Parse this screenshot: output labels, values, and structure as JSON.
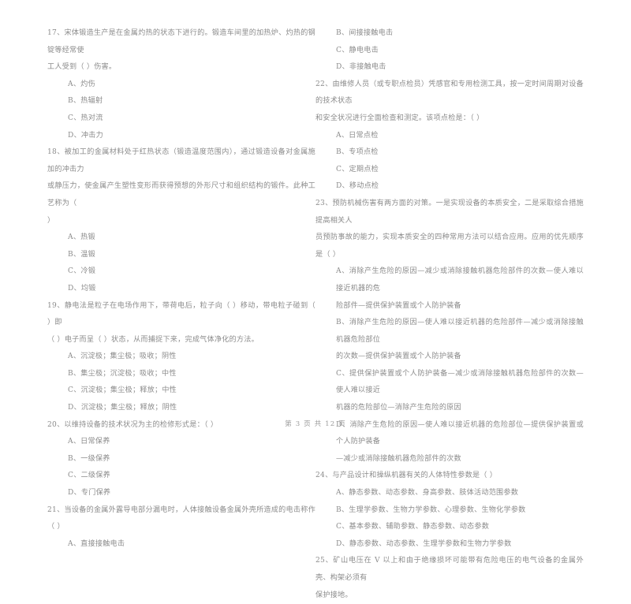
{
  "document": {
    "type": "exam-paper",
    "language": "zh-CN",
    "footer": "第 3 页  共 12 页",
    "text_color": "#8b8b8b",
    "background_color": "#ffffff"
  },
  "left_column": {
    "questions": [
      {
        "number": "17",
        "stem_lines": [
          "17、宋体锻造生产是在金属灼热的状态下进行的。锻造车间里的加热炉、灼热的钢锭等经常使",
          "工人受到（      ）伤害。"
        ],
        "options": [
          "A、灼伤",
          "B、热辐射",
          "C、热对流",
          "D、冲击力"
        ]
      },
      {
        "number": "18",
        "stem_lines": [
          "18、被加工的金属材料处于红热状态（锻造温度范围内），通过锻造设备对金属施加的冲击力",
          "或静压力，使金属产生塑性变形而获得预想的外形尺寸和组织结构的锻件。此种工艺称为（",
          "）"
        ],
        "options": [
          "A、热锻",
          "B、温锻",
          "C、冷锻",
          "D、均锻"
        ]
      },
      {
        "number": "19",
        "stem_lines": [
          "19、静电法是粒子在电场作用下，带荷电后，粒子向（      ）移动，带电粒子碰到（      ）即",
          "（      ）电子而呈（      ）状态，从而捕捉下来，完成气体净化的方法。"
        ],
        "options": [
          "A、沉淀极；集尘极；吸收；阴性",
          "B、集尘极；沉淀极；吸收；中性",
          "C、沉淀极；集尘极；释放；中性",
          "D、沉淀极；集尘极；释放；阴性"
        ]
      },
      {
        "number": "20",
        "stem_lines": [
          "20、以维持设备的技术状况为主的检修形式是：（      ）"
        ],
        "options": [
          "A、日常保养",
          "B、一级保养",
          "C、二级保养",
          "D、专门保养"
        ]
      },
      {
        "number": "21",
        "stem_lines": [
          "21、当设备的金属外露导电部分漏电时，人体接触设备金属外壳所造成的电击称作（      ）"
        ],
        "options": [
          "A、直接接触电击"
        ]
      }
    ]
  },
  "right_column": {
    "questions": [
      {
        "number": "21-cont",
        "stem_lines": [],
        "options": [
          "B、间接接触电击",
          "C、静电电击",
          "D、非接触电击"
        ]
      },
      {
        "number": "22",
        "stem_lines": [
          "22、由维修人员（或专职点检员）凭感官和专用检测工具，按一定时间周期对设备的技术状态",
          "和安全状况进行全面检查和测定。该项点检是：（      ）"
        ],
        "options": [
          "A、日常点检",
          "B、专项点检",
          "C、定期点检",
          "D、移动点检"
        ]
      },
      {
        "number": "23",
        "stem_lines": [
          "23、预防机械伤害有两方面的对策。一是实现设备的本质安全，二是采取综合措施提高相关人",
          "员预防事故的能力，实现本质安全的四种常用方法可以结合应用。应用的优先顺序是（      ）"
        ],
        "options_wrapped": [
          [
            "A、消除产生危险的原因—减少或消除接触机器危险部件的次数—使人难以接近机器的危",
            "险部件—提供保护装置或个人防护装备"
          ],
          [
            "B、消除产生危险的原因—使人难以接近机器的危险部件—减少或消除接触机器危险部位",
            "的次数—提供保护装置或个人防护装备"
          ],
          [
            "C、提供保护装置或个人防护装备—减少或消除接触机器危险部件的次数—使人难以接近",
            "机器的危险部位—消除产生危险的原因"
          ],
          [
            "D、消除产生危险的原因—使人难以接近机器的危险部位—提供保护装置或个人防护装备",
            "—减少或消除接触机器危险部件的次数"
          ]
        ]
      },
      {
        "number": "24",
        "stem_lines": [
          "24、与产品设计和操纵机器有关的人体特性参数是（      ）"
        ],
        "options": [
          "A、静态参数、动态参数、身高参数、肢体活动范围参数",
          "B、生理学参数、生物力学参数、心理参数、生物化学参数",
          "C、基本参数、辅助参数、静态参数、动态参数",
          "D、静态参数、动态参数、生理学参数和生物力学参数"
        ]
      },
      {
        "number": "25",
        "stem_lines": [
          "25、矿山电压在 V 以上和由于绝缘损坏可能带有危险电压的电气设备的金属外壳、构架必须有",
          "保护接地。"
        ],
        "options": []
      }
    ]
  }
}
